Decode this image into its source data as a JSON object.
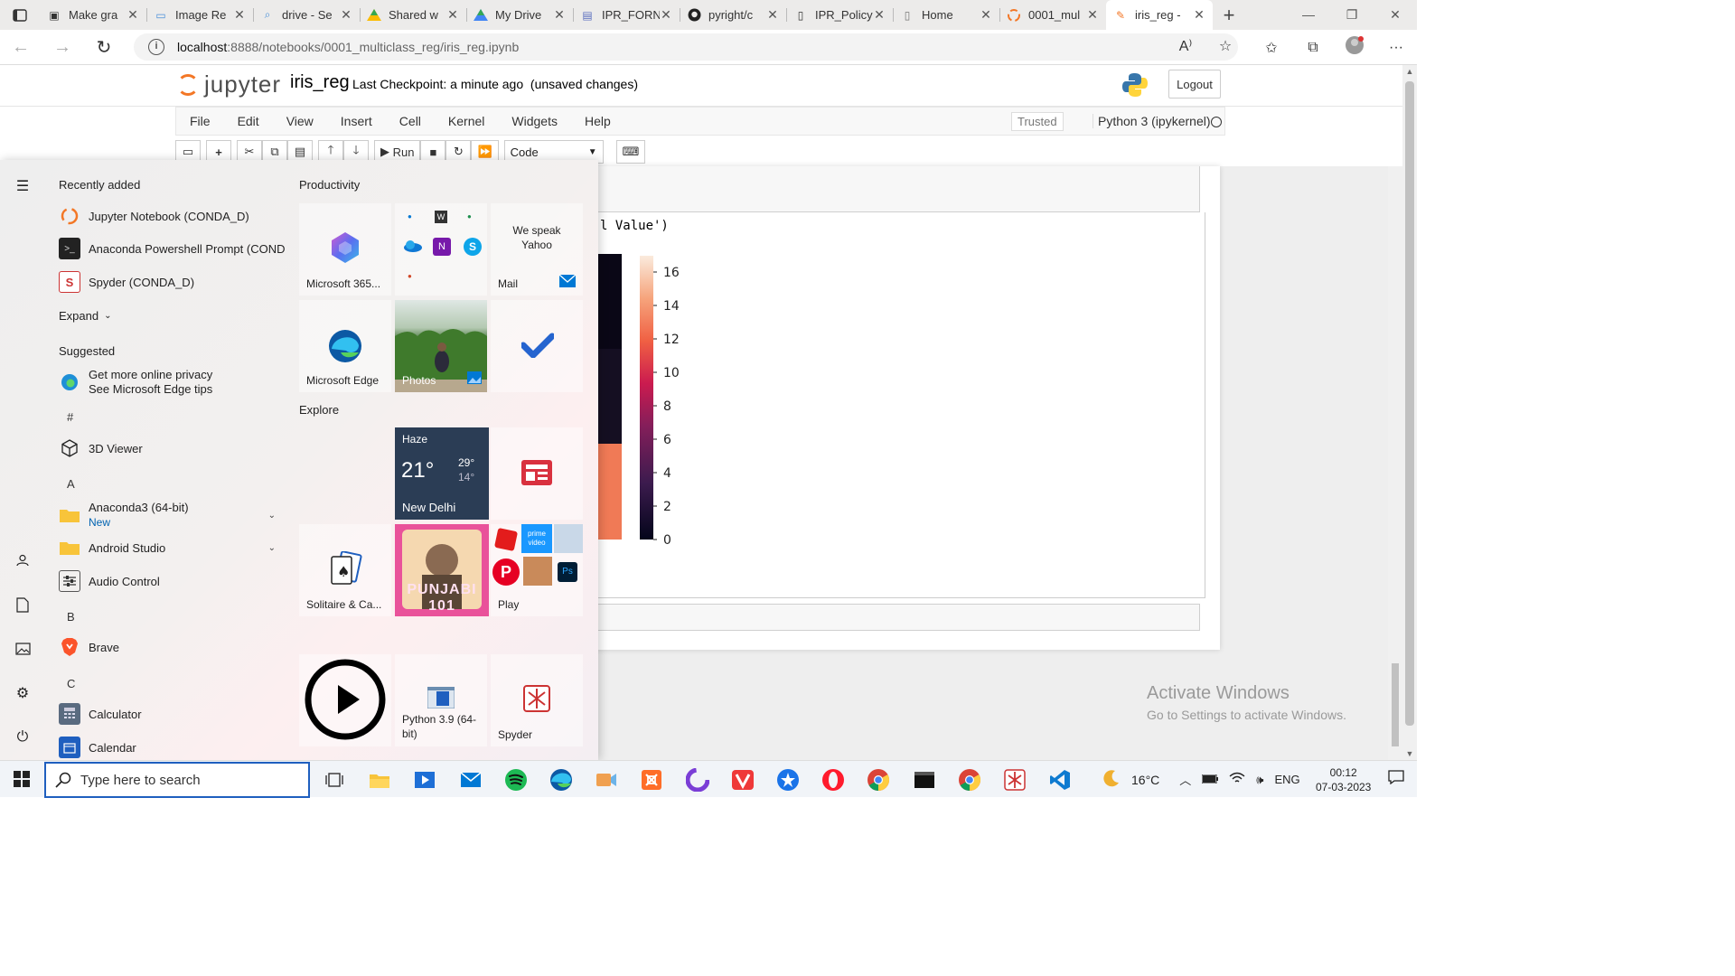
{
  "browser": {
    "tabs": [
      {
        "title": "Make gra",
        "icon": "notebook-icon",
        "active": false
      },
      {
        "title": "Image Re",
        "icon": "image-icon",
        "active": false
      },
      {
        "title": "drive - Se",
        "icon": "search-icon",
        "active": false
      },
      {
        "title": "Shared w",
        "icon": "google-drive-icon",
        "active": false
      },
      {
        "title": "My Drive",
        "icon": "google-drive-icon",
        "active": false
      },
      {
        "title": "IPR_FORN",
        "icon": "forms-icon",
        "active": false
      },
      {
        "title": "pyright/c",
        "icon": "github-icon",
        "active": false
      },
      {
        "title": "IPR_Policy",
        "icon": "document-icon",
        "active": false
      },
      {
        "title": "Home",
        "icon": "page-icon",
        "active": false
      },
      {
        "title": "0001_mul",
        "icon": "jupyter-icon",
        "active": false
      },
      {
        "title": "iris_reg -",
        "icon": "notebook-icon",
        "active": true
      }
    ],
    "url_host": "localhost",
    "url_path": ":8888/notebooks/0001_multiclass_reg/iris_reg.ipynb"
  },
  "jupyter": {
    "logo_text": "jupyter",
    "notebook_name": "iris_reg",
    "checkpoint": "Last Checkpoint: a minute ago",
    "unsaved": "(unsaved changes)",
    "logout": "Logout",
    "menus": [
      "File",
      "Edit",
      "View",
      "Insert",
      "Cell",
      "Kernel",
      "Widgets",
      "Help"
    ],
    "trusted": "Trusted",
    "kernel": "Python 3 (ipykernel)",
    "run_label": "Run",
    "cell_type": "Code",
    "code_fragment": "l Value')"
  },
  "chart_data": {
    "type": "heatmap",
    "colorbar_ticks": [
      0,
      2,
      4,
      6,
      8,
      10,
      12,
      14,
      16
    ],
    "colorbar_range": [
      0,
      16
    ],
    "colormap": "rocket"
  },
  "watermark": {
    "title": "Activate Windows",
    "subtitle": "Go to Settings to activate Windows."
  },
  "startmenu": {
    "recently_added_title": "Recently added",
    "recent": [
      {
        "label": "Jupyter Notebook (CONDA_D)",
        "icon": "jupyter-icon"
      },
      {
        "label": "Anaconda Powershell Prompt (COND...",
        "icon": "terminal-icon"
      },
      {
        "label": "Spyder (CONDA_D)",
        "icon": "spyder-icon"
      }
    ],
    "expand": "Expand",
    "suggested_title": "Suggested",
    "suggested_line1": "Get more online privacy",
    "suggested_line2": "See Microsoft Edge tips",
    "letters": [
      "#",
      "A",
      "B",
      "C"
    ],
    "apps": {
      "viewer3d": "3D Viewer",
      "anaconda": "Anaconda3 (64-bit)",
      "anaconda_new": "New",
      "android": "Android Studio",
      "audio": "Audio Control",
      "brave": "Brave",
      "calculator": "Calculator",
      "calendar": "Calendar"
    },
    "groups": {
      "productivity": "Productivity",
      "explore": "Explore"
    },
    "tiles": {
      "m365": "Microsoft 365...",
      "mail_text1": "We speak",
      "mail_text2": "Yahoo",
      "mail": "Mail",
      "edge": "Microsoft Edge",
      "photos": "Photos",
      "weather_cond": "Haze",
      "weather_temp": "21°",
      "weather_high": "29°",
      "weather_low": "14°",
      "weather_city": "New Delhi",
      "solitaire": "Solitaire & Ca...",
      "spotify_art": "PUNJABI 101",
      "play": "Play",
      "python": "Python 3.9 (64-bit)",
      "spyder": "Spyder"
    }
  },
  "taskbar": {
    "search_placeholder": "Type here to search",
    "weather": "16°C",
    "lang": "ENG",
    "time": "00:12",
    "date": "07-03-2023"
  }
}
